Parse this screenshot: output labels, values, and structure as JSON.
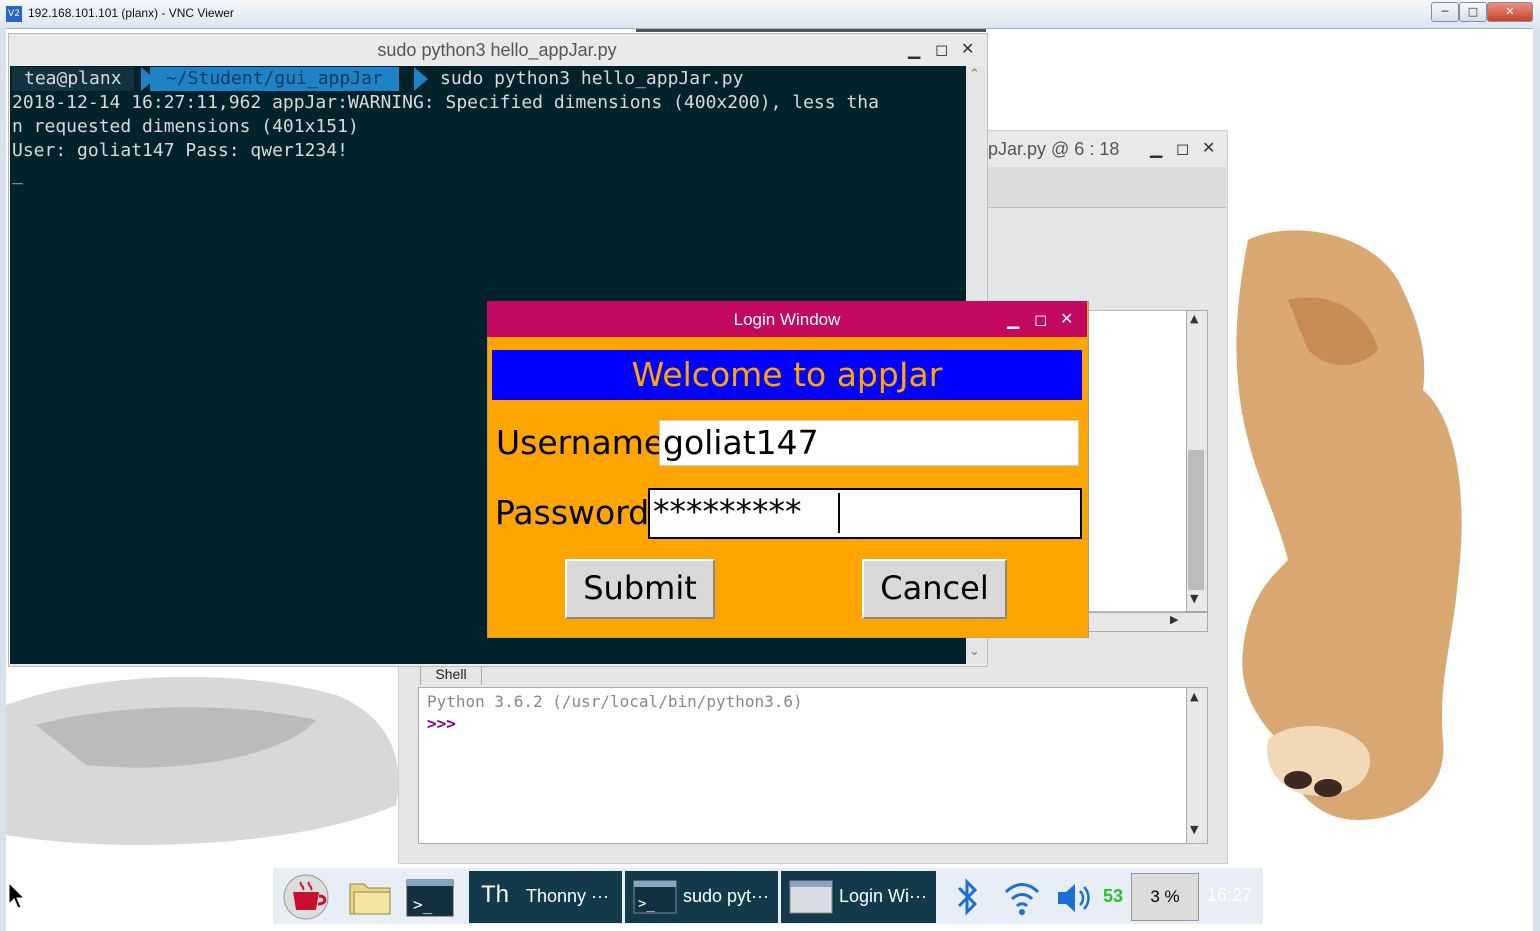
{
  "vnc": {
    "title": "192.168.101.101 (planx) - VNC Viewer",
    "logo": "V2",
    "minimize": "─",
    "maximize": "□",
    "close": "✕"
  },
  "terminal": {
    "title": "sudo python3 hello_appJar.py",
    "prompt_user": "tea@planx",
    "prompt_path": "~/Student/gui_appJar",
    "command": "sudo python3 hello_appJar.py",
    "lines": [
      "2018-12-14 16:27:11,962 appJar:WARNING: Specified dimensions (400x200), less tha",
      "n requested dimensions (401x151)",
      "User: goliat147 Pass: qwer1234!",
      "_"
    ]
  },
  "thonny": {
    "title": "pJar.py  @  6 : 18",
    "shell_tab": "Shell",
    "shell_version": "Python 3.6.2 (/usr/local/bin/python3.6)",
    "shell_prompt": ">>>"
  },
  "login": {
    "title": "Login Window",
    "welcome": "Welcome to appJar",
    "username_label": "Username",
    "username_value": "goliat147",
    "password_label": "Password",
    "password_value": "*********",
    "submit": "Submit",
    "cancel": "Cancel"
  },
  "taskbar": {
    "tasks": [
      {
        "label": "Thonny  ···",
        "icon": "thonny-icon"
      },
      {
        "label": "sudo pyt···",
        "icon": "terminal-icon"
      },
      {
        "label": "Login Wi···",
        "icon": "window-icon"
      }
    ],
    "volume_level": "53",
    "cpu": "3 %",
    "clock": "16:27"
  },
  "colors": {
    "login_titlebar": "#c2095f",
    "login_background": "#ffa500",
    "welcome_banner": "#0000ff",
    "terminal_background": "#00232b"
  }
}
